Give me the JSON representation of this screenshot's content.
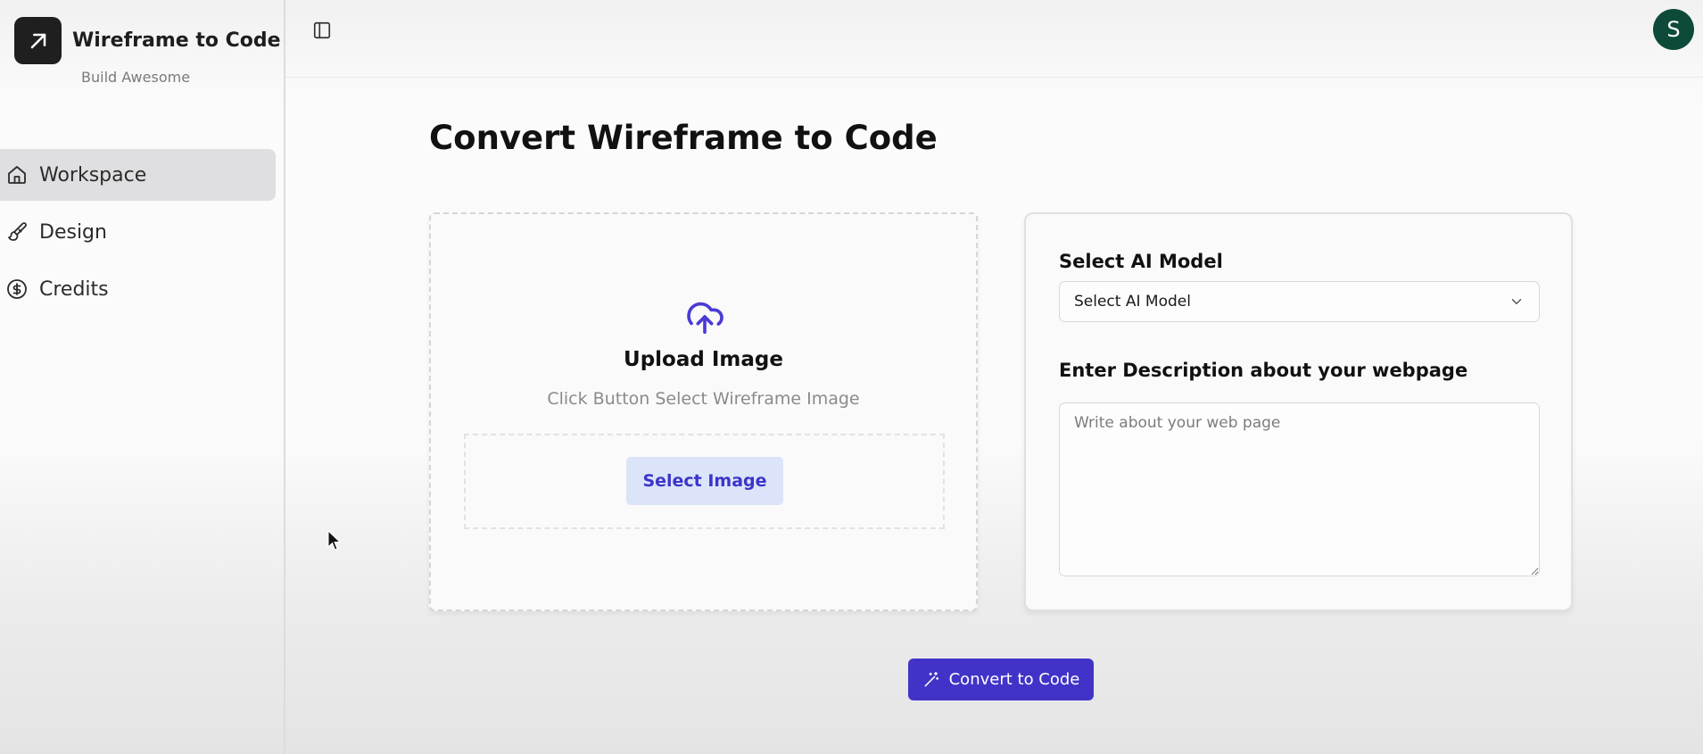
{
  "brand": {
    "title": "Wireframe to Code",
    "subtitle": "Build Awesome",
    "logo_icon": "arrow-up-right-icon"
  },
  "sidebar": {
    "items": [
      {
        "label": "Workspace",
        "icon": "home-icon",
        "active": true
      },
      {
        "label": "Design",
        "icon": "paintbrush-icon",
        "active": false
      },
      {
        "label": "Credits",
        "icon": "dollar-circle-icon",
        "active": false
      }
    ]
  },
  "header": {
    "toggle_icon": "panel-left-icon",
    "avatar_letter": "S",
    "avatar_color": "#0e4a3a"
  },
  "main": {
    "title": "Convert Wireframe to Code",
    "upload": {
      "title": "Upload Image",
      "hint": "Click Button Select Wireframe Image",
      "button_label": "Select Image"
    },
    "model": {
      "label": "Select AI Model",
      "selected": "Select AI Model"
    },
    "description": {
      "label": "Enter Description about your webpage",
      "placeholder": "Write about your web page",
      "value": ""
    },
    "convert_button": "Convert to Code"
  },
  "colors": {
    "accent": "#4233c8",
    "upload_icon": "#4a3bd6",
    "select_button_bg": "#dbe4f9"
  }
}
